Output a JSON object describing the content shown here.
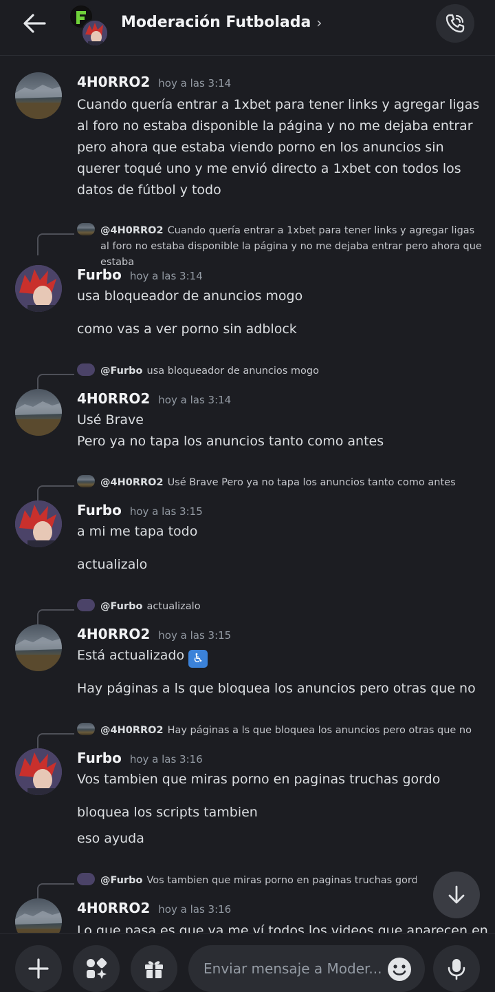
{
  "header": {
    "title": "Moderación Futbolada",
    "chevron": "›",
    "back_icon": "arrow-left-icon",
    "call_icon": "phone-icon"
  },
  "messages": [
    {
      "author": "4H0RRO2",
      "timestamp": "hoy a las 3:14",
      "lines": [
        "Cuando quería entrar a 1xbet para tener links y agregar ligas al foro no estaba disponible la página y no me dejaba entrar pero ahora que estaba viendo porno en los anuncios sin querer toqué uno y me envió directo a 1xbet con todos los datos de fútbol y todo"
      ]
    },
    {
      "reply": {
        "name": "@4H0RRO2",
        "text": "Cuando quería entrar a 1xbet para tener links y agregar ligas al foro no estaba disponible la página y no me dejaba entrar pero ahora que estaba"
      },
      "author": "Furbo",
      "timestamp": "hoy a las 3:14",
      "lines": [
        "usa bloqueador de anuncios mogo",
        "como vas a ver porno sin adblock"
      ]
    },
    {
      "reply": {
        "name": "@Furbo",
        "text": "usa bloqueador de anuncios mogo"
      },
      "author": "4H0RRO2",
      "timestamp": "hoy a las 3:14",
      "lines": [
        "Usé Brave",
        "Pero ya no tapa los anuncios tanto como antes"
      ]
    },
    {
      "reply": {
        "name": "@4H0RRO2",
        "text": "Usé Brave Pero ya no tapa los anuncios tanto como antes"
      },
      "author": "Furbo",
      "timestamp": "hoy a las 3:15",
      "lines": [
        "a mi me tapa todo",
        "actualizalo"
      ]
    },
    {
      "reply": {
        "name": "@Furbo",
        "text": "actualizalo"
      },
      "author": "4H0RRO2",
      "timestamp": "hoy a las 3:15",
      "lines": [
        "Está actualizado",
        "Hay páginas a ls que bloquea los anuncios pero otras que no"
      ],
      "emoji": "♿"
    },
    {
      "reply": {
        "name": "@4H0RRO2",
        "text": "Hay páginas a ls que bloquea los anuncios pero otras que no"
      },
      "author": "Furbo",
      "timestamp": "hoy a las 3:16",
      "lines": [
        "Vos tambien que miras porno en paginas truchas gordo",
        "bloquea los scripts tambien",
        "eso ayuda"
      ]
    },
    {
      "reply": {
        "name": "@Furbo",
        "text": "Vos tambien que miras porno en paginas truchas gordo"
      },
      "author": "4H0RRO2",
      "timestamp": "hoy a las 3:16",
      "lines": [
        "Lo que pasa es que ya me ví todos los videos que aparecen en"
      ]
    }
  ],
  "composer": {
    "placeholder": "Enviar mensaje a Moder...",
    "buttons": [
      "plus-icon",
      "apps-icon",
      "gift-icon"
    ],
    "emoji_icon": "smiley-icon",
    "mic_icon": "microphone-icon"
  },
  "scroll_icon": "arrow-down-icon"
}
